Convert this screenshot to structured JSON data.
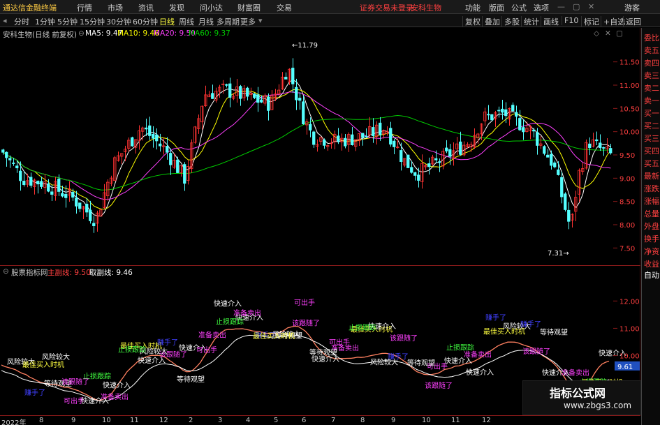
{
  "menu": {
    "app_title": "通达信金融终端",
    "items": [
      "行情",
      "市场",
      "资讯",
      "发现",
      "问小达",
      "财富圈",
      "交易"
    ],
    "notice": "证券交易未登录",
    "stock_name": "安科生物",
    "right_items": [
      "功能",
      "版面",
      "公式",
      "选项"
    ],
    "guest": "游客"
  },
  "periods": [
    "分时",
    "1分钟",
    "5分钟",
    "15分钟",
    "30分钟",
    "60分钟",
    "日线",
    "周线",
    "月线",
    "多周期",
    "更多"
  ],
  "tools": [
    "复权",
    "叠加",
    "多股",
    "统计",
    "画线",
    "F10",
    "标记",
    "+自选",
    "返回"
  ],
  "main_info": {
    "title": "安科生物(日线 前复权)",
    "ma5": "MA5: 9.47",
    "ma10": "MA10: 9.46",
    "ma20": "MA20: 9.50",
    "ma60": "MA60: 9.37"
  },
  "sub_info": {
    "title": "股票指标网",
    "line1": "主副线: 9.50",
    "line2": "取副线: 9.46"
  },
  "side_items": [
    "委比",
    "卖五",
    "卖四",
    "卖三",
    "卖二",
    "卖一",
    "买一",
    "买二",
    "买三",
    "买四",
    "买五",
    "最新",
    "涨跌",
    "涨幅",
    "总量",
    "外盘",
    "换手",
    "净资",
    "收益"
  ],
  "side_auto": "自动",
  "price_axis": [
    "11.50",
    "11.00",
    "10.50",
    "10.00",
    "9.50",
    "9.00",
    "8.50",
    "8.00",
    "7.50"
  ],
  "sub_axis": [
    "12.00",
    "11.00",
    "10.00",
    "9.00"
  ],
  "sub_current": "9.61",
  "high_label": "11.79",
  "low_label": "7.31",
  "bottom_axis": [
    "2022年",
    "8",
    "9",
    "10",
    "11",
    "12",
    "2",
    "3",
    "4",
    "5",
    "6",
    "7",
    "8",
    "9",
    "10",
    "11",
    "12"
  ],
  "annotations": [
    {
      "text": "风险较大",
      "color": "#ffffff"
    },
    {
      "text": "快速介入",
      "color": "#ffffff"
    },
    {
      "text": "准备卖出",
      "color": "#ff40ff"
    },
    {
      "text": "可出手",
      "color": "#ff40ff"
    },
    {
      "text": "该跟随了",
      "color": "#ff40ff"
    },
    {
      "text": "赚手了",
      "color": "#4040ff"
    },
    {
      "text": "最佳买入时机",
      "color": "#ffff40"
    },
    {
      "text": "止损跟踪",
      "color": "#40ff40"
    },
    {
      "text": "快速介入",
      "color": "#ffffff"
    },
    {
      "text": "等待观望",
      "color": "#ffffff"
    }
  ],
  "watermark": {
    "title": "指标公式网",
    "url": "www.zbgs3.com"
  },
  "colors": {
    "up": "#ff3232",
    "down": "#54ffff",
    "ma5": "#ffffff",
    "ma10": "#ffff00",
    "ma20": "#ff40ff",
    "ma60": "#00cc00"
  }
}
